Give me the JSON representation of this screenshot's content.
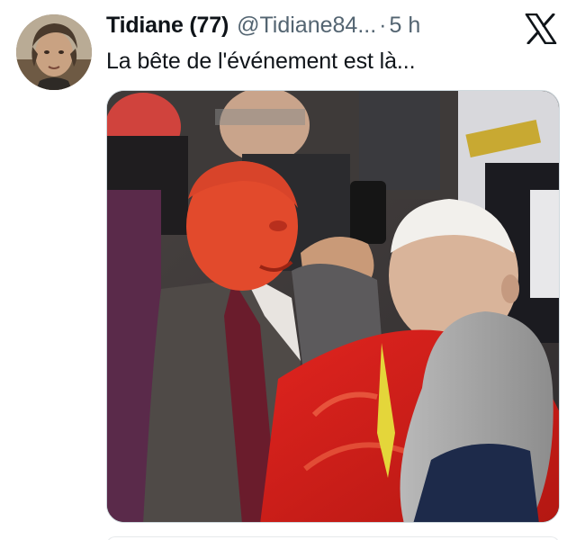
{
  "tweet": {
    "author": {
      "display_name": "Tidiane (77)",
      "handle": "@Tidiane84...",
      "separator": "·",
      "timestamp": "5 h"
    },
    "text": "La bête de l'événement est là...",
    "platform_icon": "x-logo-icon",
    "media_icon": "photo"
  },
  "colors": {
    "text_primary": "#0f1419",
    "text_secondary": "#536471",
    "background": "#ffffff",
    "media_border": "#cfd9de"
  }
}
